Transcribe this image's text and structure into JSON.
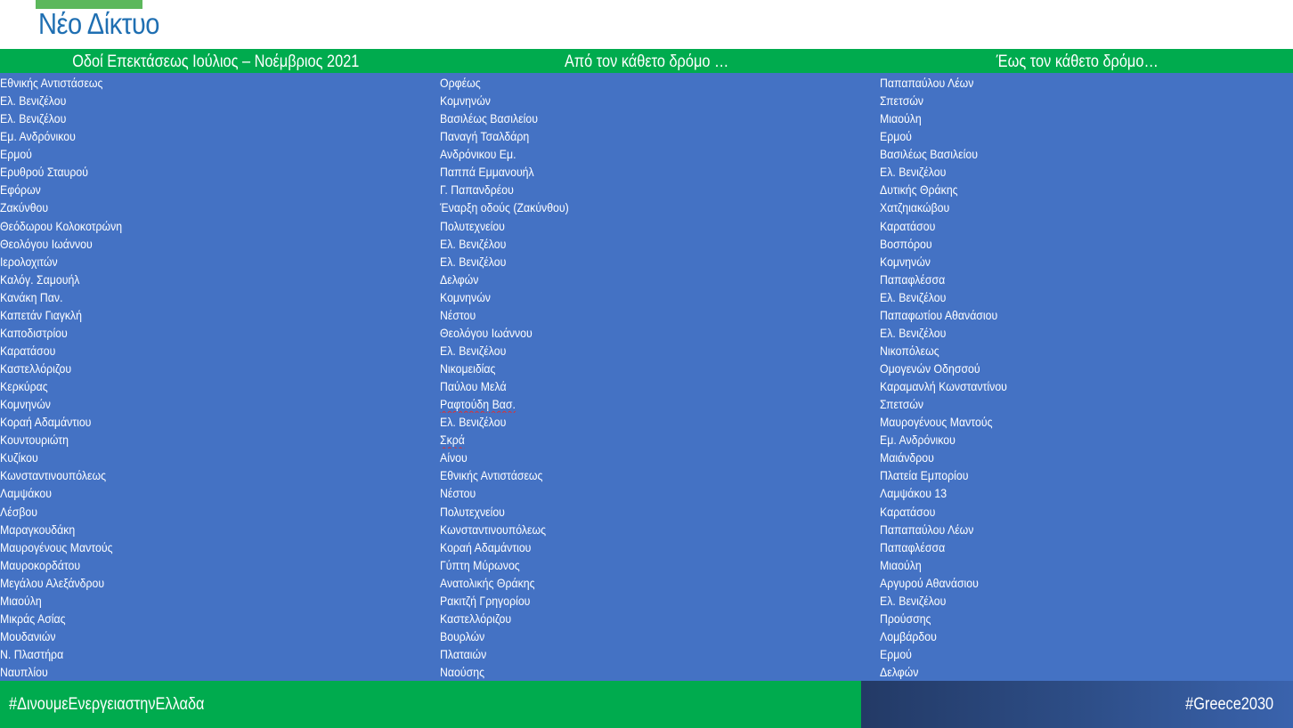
{
  "slide": {
    "title": "Νέο Δίκτυο",
    "colors": {
      "title": "#1f6fb2",
      "accent_bar": "#5cb85c",
      "header_bg": "#00ab4e",
      "table_bg": "#4472c4",
      "footer_left_bg": "#00ab4e",
      "footer_right_bg": "#2d4d86",
      "text": "#ffffff"
    }
  },
  "table": {
    "headers": [
      "Οδοί Επεκτάσεως Ιούλιος – Νοέμβριος 2021",
      "Από τον κάθετο δρόμο …",
      "Έως τον κάθετο δρόμο…"
    ],
    "rows": [
      [
        "Εθνικής Αντιστάσεως",
        "Ορφέως",
        "Παπαπαύλου Λέων"
      ],
      [
        "Ελ. Βενιζέλου",
        "Κομνηνών",
        "Σπετσών"
      ],
      [
        "Ελ. Βενιζέλου",
        "Βασιλέως Βασιλείου",
        "Μιαούλη"
      ],
      [
        "Εμ. Ανδρόνικου",
        "Παναγή Τσαλδάρη",
        "Ερμού"
      ],
      [
        "Ερμού",
        "Ανδρόνικου Εμ.",
        "Βασιλέως Βασιλείου"
      ],
      [
        "Ερυθρού Σταυρού",
        "Παππά Εμμανουήλ",
        "Ελ. Βενιζέλου"
      ],
      [
        "Εφόρων",
        "Γ. Παπανδρέου",
        "Δυτικής Θράκης"
      ],
      [
        "Ζακύνθου",
        "Έναρξη οδούς (Ζακύνθου)",
        "Χατζηιακώβου"
      ],
      [
        "Θεόδωρου Κολοκοτρώνη",
        "Πολυτεχνείου",
        "Καρατάσου"
      ],
      [
        "Θεολόγου Ιωάννου",
        "Ελ. Βενιζέλου",
        "Βοσπόρου"
      ],
      [
        "Ιερολοχιτών",
        "Ελ. Βενιζέλου",
        "Κομνηνών"
      ],
      [
        "Καλόγ. Σαμουήλ",
        "Δελφών",
        "Παπαφλέσσα"
      ],
      [
        "Κανάκη Παν.",
        "Κομνηνών",
        "Ελ. Βενιζέλου"
      ],
      [
        "Καπετάν Γιαγκλή",
        "Νέστου",
        "Παπαφωτίου Αθανάσιου"
      ],
      [
        "Καποδιστρίου",
        "Θεολόγου Ιωάννου",
        "Ελ. Βενιζέλου"
      ],
      [
        "Καρατάσου",
        "Ελ. Βενιζέλου",
        "Νικοπόλεως"
      ],
      [
        "Καστελλόριζου",
        "Νικομειδίας",
        "Ομογενών Οδησσού"
      ],
      [
        "Κερκύρας",
        "Παύλου Μελά",
        "Καραμανλή Κωνσταντίνου"
      ],
      [
        "Κομνηνών",
        "Ραφτούδη Βασ.",
        "Σπετσών"
      ],
      [
        "Κοραή Αδαμάντιου",
        "Ελ. Βενιζέλου",
        "Μαυρογένους Μαντούς"
      ],
      [
        "Κουντουριώτη",
        "Σκρά",
        "Εμ. Ανδρόνικου"
      ],
      [
        "Κυζίκου",
        "Αίνου",
        "Μαιάνδρου"
      ],
      [
        "Κωνσταντινουπόλεως",
        "Εθνικής Αντιστάσεως",
        "Πλατεία Εμπορίου"
      ],
      [
        "Λαμψάκου",
        "Νέστου",
        "Λαμψάκου 13"
      ],
      [
        "Λέσβου",
        "Πολυτεχνείου",
        "Καρατάσου"
      ],
      [
        "Μαραγκουδάκη",
        "Κωνσταντινουπόλεως",
        "Παπαπαύλου Λέων"
      ],
      [
        "Μαυρογένους Μαντούς",
        "Κοραή Αδαμάντιου",
        "Παπαφλέσσα"
      ],
      [
        "Μαυροκορδάτου",
        "Γύπτη Μύρωνος",
        "Μιαούλη"
      ],
      [
        "Μεγάλου Αλεξάνδρου",
        "Ανατολικής Θράκης",
        "Αργυρού Αθανάσιου"
      ],
      [
        "Μιαούλη",
        "Ρακιτζή Γρηγορίου",
        "Ελ. Βενιζέλου"
      ],
      [
        "Μικράς Ασίας",
        "Καστελλόριζου",
        "Προύσσης"
      ],
      [
        "Μουδανιών",
        "Βουρλών",
        "Λομβάρδου"
      ],
      [
        "Ν. Πλαστήρα",
        "Πλαταιών",
        "Ερμού"
      ],
      [
        "Ναυπλίου",
        "Ναούσης",
        "Δελφών"
      ]
    ]
  },
  "footer": {
    "left_hashtag": "#ΔινουμεΕνεργειαστηνΕλλαδα",
    "right_hashtag": "#Greece2030"
  }
}
